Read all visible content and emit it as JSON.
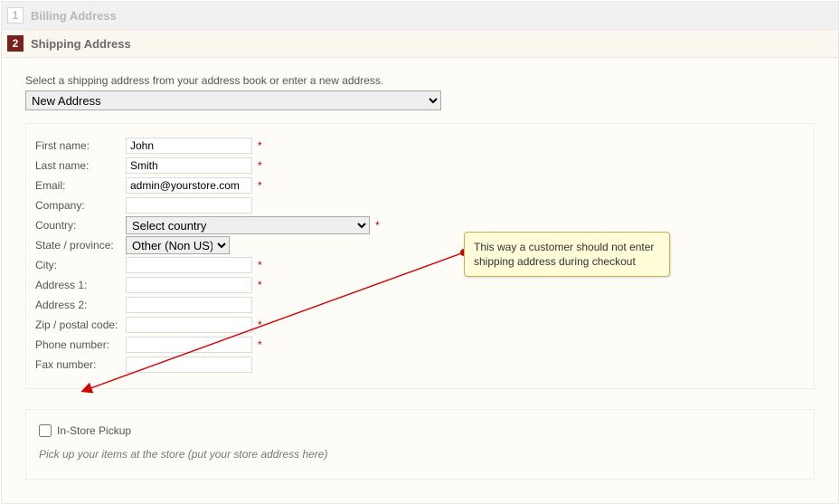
{
  "steps": {
    "billing": {
      "num": "1",
      "title": "Billing Address"
    },
    "shipping": {
      "num": "2",
      "title": "Shipping Address"
    }
  },
  "instruction": "Select a shipping address from your address book or enter a new address.",
  "address_select": {
    "value": "New Address"
  },
  "labels": {
    "first_name": "First name:",
    "last_name": "Last name:",
    "email": "Email:",
    "company": "Company:",
    "country": "Country:",
    "state": "State / province:",
    "city": "City:",
    "address1": "Address 1:",
    "address2": "Address 2:",
    "zip": "Zip / postal code:",
    "phone": "Phone number:",
    "fax": "Fax number:"
  },
  "values": {
    "first_name": "John",
    "last_name": "Smith",
    "email": "admin@yourstore.com",
    "company": "",
    "country": "Select country",
    "state": "Other (Non US)",
    "city": "",
    "address1": "",
    "address2": "",
    "zip": "",
    "phone": "",
    "fax": ""
  },
  "pickup": {
    "label": "In-Store Pickup",
    "desc": "Pick up your items at the store (put your store address here)"
  },
  "callout": {
    "text": "This way a customer should not enter shipping address during checkout"
  }
}
